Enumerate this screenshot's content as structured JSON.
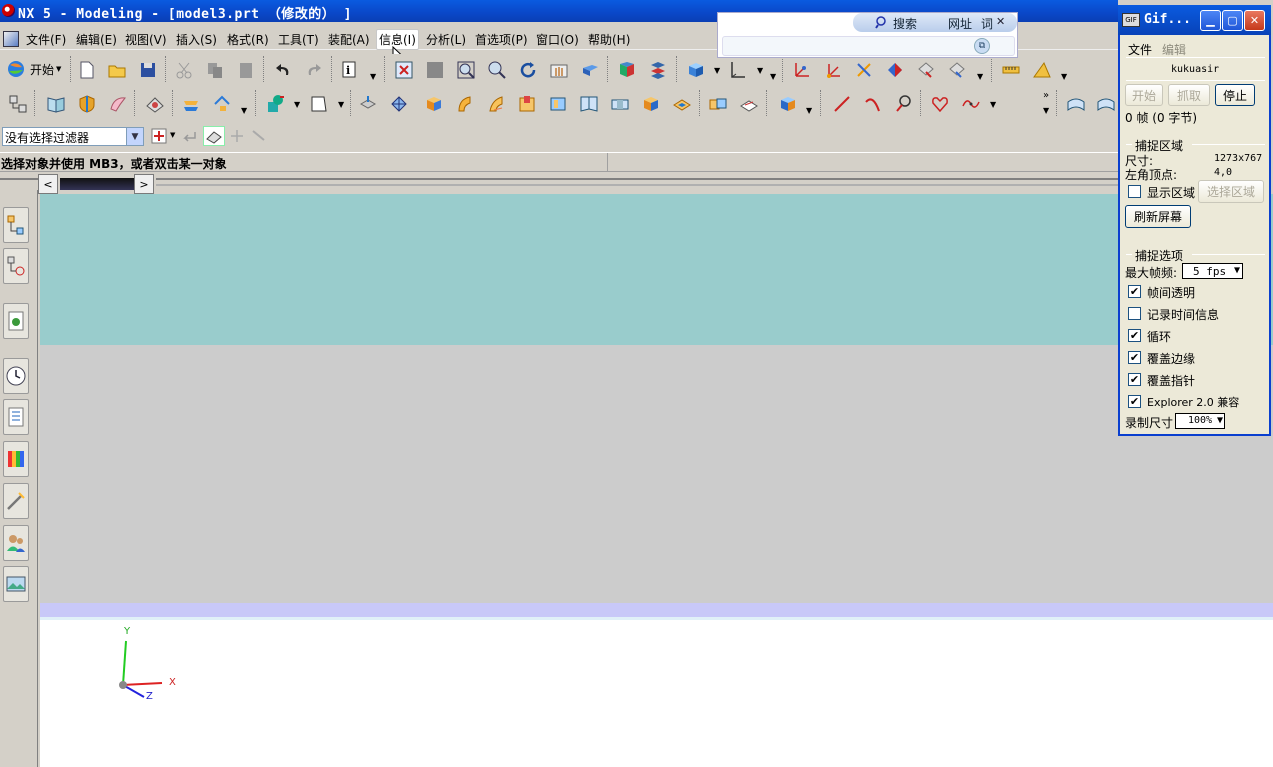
{
  "window": {
    "title": "NX 5 - Modeling - [model3.prt （修改的） ]"
  },
  "menubar": {
    "items": [
      {
        "label": "文件(F)"
      },
      {
        "label": "编辑(E)"
      },
      {
        "label": "视图(V)"
      },
      {
        "label": "插入(S)"
      },
      {
        "label": "格式(R)"
      },
      {
        "label": "工具(T)"
      },
      {
        "label": "装配(A)"
      },
      {
        "label": "信息(I)",
        "active": true
      },
      {
        "label": "分析(L)"
      },
      {
        "label": "首选项(P)"
      },
      {
        "label": "窗口(O)"
      },
      {
        "label": "帮助(H)"
      }
    ]
  },
  "toolbar": {
    "start_label": "开始"
  },
  "filter": {
    "selected": "没有选择过滤器"
  },
  "cue": {
    "text": "选择对象并使用 MB3，或者双击某一对象"
  },
  "searchbar": {
    "search_label": "搜索",
    "url_label": "网址",
    "word_label": "词"
  },
  "triad": {
    "x": "X",
    "y": "Y",
    "z": "Z"
  },
  "gif_window": {
    "title": "Gif...",
    "menu": {
      "file": "文件",
      "edit": "编辑"
    },
    "name": "kukuasir",
    "buttons": {
      "start": "开始",
      "grab": "抓取",
      "stop": "停止"
    },
    "frames": "0 帧 (0 字节)",
    "capture_area": {
      "heading": "捕捉区域",
      "size_label": "尺寸:",
      "size_value": "1273x767",
      "corner_label": "左角顶点:",
      "corner_value": "4,0",
      "show_area": "显示区域",
      "select_area": "选择区域",
      "refresh": "刷新屏幕"
    },
    "capture_options": {
      "heading": "捕捉选项",
      "max_fps_label": "最大帧频:",
      "max_fps_value": "5 fps",
      "options": [
        {
          "label": "帧间透明",
          "checked": true
        },
        {
          "label": "记录时间信息",
          "checked": false
        },
        {
          "label": "循环",
          "checked": true
        },
        {
          "label": "覆盖边缘",
          "checked": true
        },
        {
          "label": "覆盖指针",
          "checked": true
        },
        {
          "label": "Explorer 2.0 兼容",
          "checked": true
        }
      ],
      "record_size_label": "录制尺寸",
      "record_size_value": "100%"
    }
  }
}
